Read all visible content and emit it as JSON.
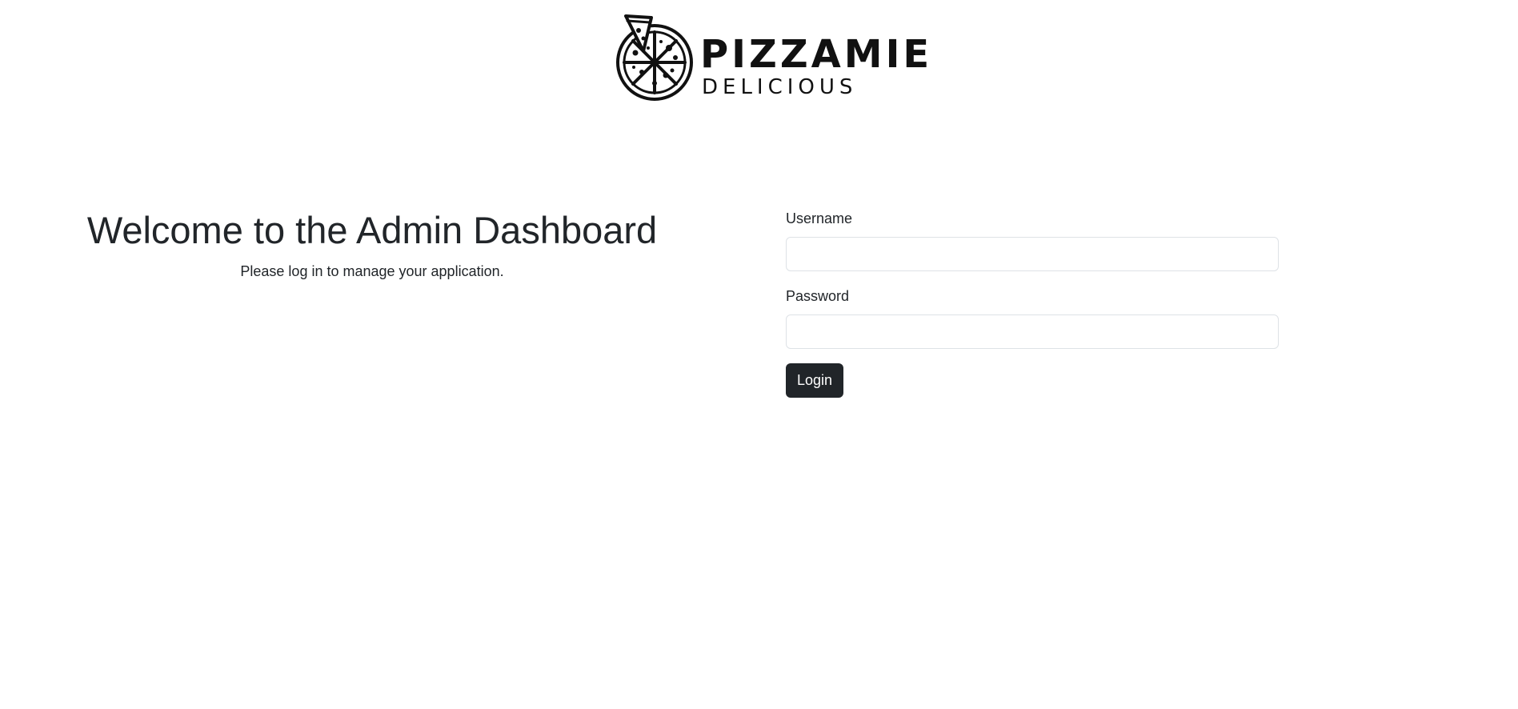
{
  "brand": {
    "name": "PIZZAMIE",
    "tagline": "DELICIOUS"
  },
  "welcome": {
    "title": "Welcome to the Admin Dashboard",
    "subtitle": "Please log in to manage your application."
  },
  "form": {
    "username_label": "Username",
    "username_value": "",
    "password_label": "Password",
    "password_value": "",
    "login_label": "Login"
  },
  "colors": {
    "button_bg": "#212529",
    "button_text": "#ffffff",
    "input_border": "#dee2e6",
    "text": "#212529"
  }
}
